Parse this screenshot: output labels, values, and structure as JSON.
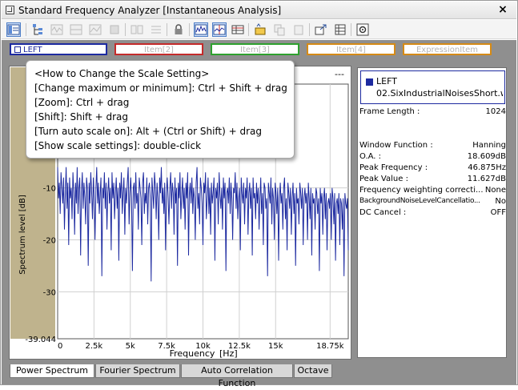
{
  "window": {
    "title": "Standard Frequency Analyzer [Instantaneous Analysis]",
    "close_label": "×"
  },
  "channel_tabs": [
    {
      "label": "LEFT",
      "color": "#1d2aa0",
      "active": true
    },
    {
      "label": "Item[2]",
      "color": "#c42a2a",
      "active": false
    },
    {
      "label": "Item[3]",
      "color": "#2ea02e",
      "active": false
    },
    {
      "label": "Item[4]",
      "color": "#d58a16",
      "active": false
    },
    {
      "label": "ExpressionItem",
      "color": "#d58a16",
      "active": false
    }
  ],
  "tooltip": {
    "lines": [
      "<How to Change the Scale Setting>",
      "[Change maximum or minimum]: Ctrl + Shift + drag",
      "[Zoom]: Ctrl + drag",
      "[Shift]: Shift + drag",
      "[Turn auto scale on]: Alt + (Ctrl or Shift) + drag",
      "[Show scale settings]: double-click"
    ]
  },
  "plot_header_dashes": "---",
  "info": {
    "legend_channel": "LEFT",
    "legend_file": "02.SixIndustrialNoisesShort.w...",
    "rows": [
      {
        "key": "Frame Length :",
        "value": "1024"
      },
      {
        "key": "Window Function :",
        "value": "Hanning"
      },
      {
        "key": "O.A. :",
        "value": "18.609dB"
      },
      {
        "key": "Peak Frequency :",
        "value": "46.875Hz"
      },
      {
        "key": "Peak Value :",
        "value": "11.627dB"
      },
      {
        "key": "Frequency weighting correcti...",
        "value": "None"
      },
      {
        "key": "BackgroundNoiseLevelCancellatio...",
        "value": "No"
      },
      {
        "key": "DC Cancel :",
        "value": "OFF"
      }
    ]
  },
  "bottom_tabs": [
    {
      "label": "Power Spectrum",
      "active": true
    },
    {
      "label": "Fourier Spectrum",
      "active": false
    },
    {
      "label": "Auto Correlation Function",
      "active": false
    },
    {
      "label": "Octave",
      "active": false
    }
  ],
  "chart_data": {
    "type": "line",
    "title": "",
    "xlabel": "Frequency",
    "xunit": "[Hz]",
    "ylabel": "Spectrum level [dB]",
    "xlim": [
      0,
      20000
    ],
    "ylim": [
      -39.044,
      10
    ],
    "x_ticks": [
      {
        "value": 0,
        "label": "0"
      },
      {
        "value": 2500,
        "label": "2.5k"
      },
      {
        "value": 5000,
        "label": "5k"
      },
      {
        "value": 7500,
        "label": "7.5k"
      },
      {
        "value": 10000,
        "label": "10k"
      },
      {
        "value": 12500,
        "label": "12.5k"
      },
      {
        "value": 15000,
        "label": "15k"
      },
      {
        "value": 18750,
        "label": "18.75k"
      }
    ],
    "y_ticks": [
      {
        "value": -10,
        "label": "-10"
      },
      {
        "value": -20,
        "label": "-20"
      },
      {
        "value": -30,
        "label": "-30"
      },
      {
        "value": -39.044,
        "label": "-39.044"
      }
    ],
    "grid": true,
    "series": [
      {
        "color": "#1d2aa0",
        "y": [
          -6,
          -12,
          -9,
          -15,
          -7,
          -10,
          -13,
          -8,
          -18,
          -11,
          -6,
          -14,
          -9,
          -21,
          -8,
          -12,
          -10,
          -16,
          -7,
          -11,
          -19,
          -9,
          -13,
          -6,
          -15,
          -10,
          -8,
          -23,
          -11,
          -7,
          -14,
          -9,
          -12,
          -17,
          -8,
          -10,
          -25,
          -9,
          -13,
          -7,
          -11,
          -16,
          -8,
          -12,
          -20,
          -10,
          -6,
          -13,
          -9,
          -15,
          -11,
          -8,
          -27,
          -10,
          -12,
          -7,
          -14,
          -9,
          -18,
          -11,
          -8,
          -13,
          -10,
          -22,
          -7,
          -12,
          -9,
          -16,
          -11,
          -8,
          -14,
          -10,
          -24,
          -9,
          -12,
          -7,
          -15,
          -11,
          -8,
          -19,
          -10,
          -13,
          -9,
          -6,
          -17,
          -11,
          -8,
          -12,
          -26,
          -10,
          -9,
          -14,
          -7,
          -13,
          -11,
          -18,
          -8,
          -10,
          -12,
          -21,
          -9,
          -7,
          -15,
          -11,
          -13,
          -8,
          -17,
          -10,
          -9,
          -12,
          -28,
          -8,
          -11,
          -14,
          -7,
          -10,
          -16,
          -9,
          -12,
          -20,
          -8,
          -11,
          -6,
          -13,
          -10,
          -15,
          -9,
          -22,
          -11,
          -8,
          -12,
          -17,
          -10,
          -7,
          -14,
          -9,
          -11,
          -19,
          -8,
          -13,
          -10,
          -25,
          -9,
          -12,
          -7,
          -16,
          -11,
          -8,
          -14,
          -10,
          -18,
          -9,
          -12,
          -7,
          -23,
          -11,
          -9,
          -13,
          -8,
          -15,
          -10,
          -12,
          -20,
          -9,
          -6,
          -14,
          -11,
          -17,
          -8,
          -10,
          -13,
          -21,
          -9,
          -11,
          -7,
          -16,
          -12,
          -8,
          -15,
          -10,
          -19,
          -9,
          -13,
          -11,
          -8,
          -24,
          -10,
          -12,
          -9,
          -17,
          -7,
          -11,
          -14,
          -10,
          -18,
          -8,
          -12,
          -9,
          -26,
          -11,
          -10,
          -13,
          -8,
          -15,
          -9,
          -12,
          -20,
          -10,
          -11,
          -7,
          -14,
          -9,
          -16,
          -12,
          -10,
          -22,
          -8,
          -11,
          -13,
          -9,
          -17,
          -10,
          -12,
          -8,
          -19,
          -11,
          -9,
          -14,
          -10,
          -23,
          -8,
          -12,
          -11,
          -16,
          -9,
          -13,
          -10,
          -18,
          -12,
          -8,
          -15,
          -11,
          -21,
          -9,
          -10,
          -14,
          -12,
          -27,
          -9,
          -11,
          -13,
          -8,
          -17,
          -10,
          -12,
          -20,
          -9,
          -11,
          -15,
          -10,
          -24,
          -12,
          -9,
          -13,
          -11,
          -18,
          -10,
          -8,
          -16,
          -12,
          -22,
          -9,
          -11,
          -14,
          -10,
          -19,
          -12,
          -9,
          -15,
          -11,
          -25,
          -10,
          -13,
          -12,
          -17,
          -9,
          -11,
          -14,
          -10,
          -21,
          -12,
          -10,
          -13,
          -11,
          -20,
          -9,
          -12,
          -16,
          -10,
          -23,
          -11,
          -13,
          -12,
          -18,
          -10,
          -11,
          -15,
          -12,
          -26,
          -10,
          -13,
          -11,
          -19,
          -12,
          -10,
          -16,
          -11,
          -22,
          -13,
          -12,
          -14,
          -11,
          -20,
          -10,
          -12,
          -17,
          -11,
          -24,
          -13,
          -12,
          -15,
          -11,
          -21,
          -12,
          -13,
          -18,
          -12,
          -27,
          -11,
          -13,
          -14,
          -12,
          -22
        ]
      }
    ]
  }
}
